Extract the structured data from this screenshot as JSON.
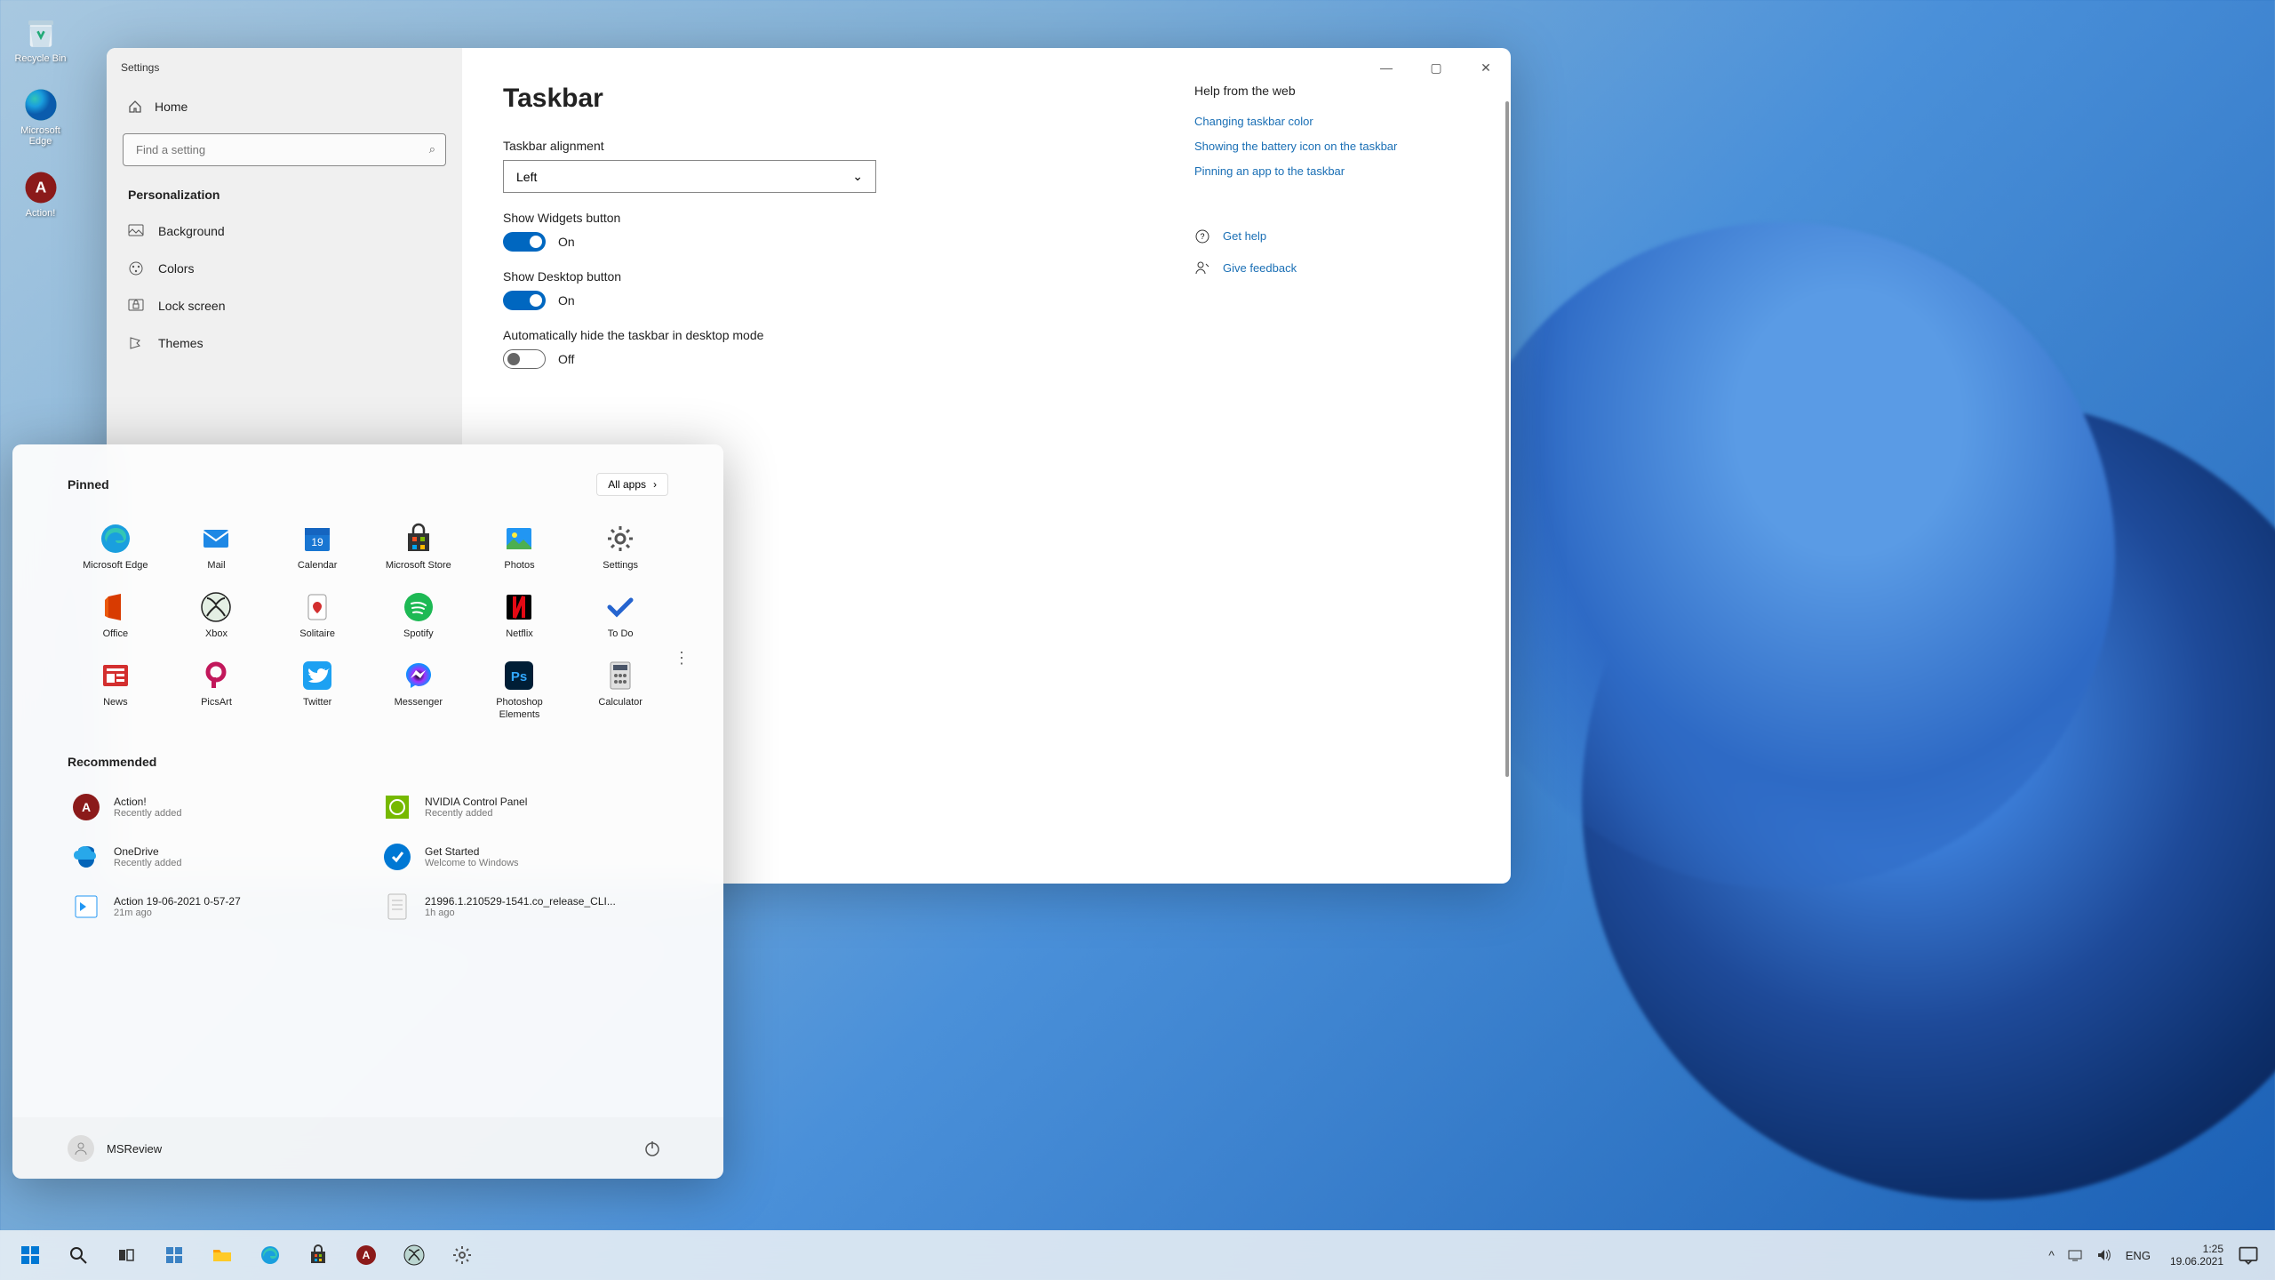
{
  "desktop": {
    "icons": [
      {
        "name": "Recycle Bin"
      },
      {
        "name": "Microsoft Edge"
      },
      {
        "name": "Action!"
      }
    ]
  },
  "settings": {
    "window_title": "Settings",
    "home_label": "Home",
    "search_placeholder": "Find a setting",
    "category": "Personalization",
    "nav": [
      {
        "label": "Background"
      },
      {
        "label": "Colors"
      },
      {
        "label": "Lock screen"
      },
      {
        "label": "Themes"
      }
    ],
    "page_title": "Taskbar",
    "alignment": {
      "label": "Taskbar alignment",
      "value": "Left"
    },
    "widgets": {
      "label": "Show Widgets button",
      "state": "On",
      "on": true
    },
    "desktop_btn": {
      "label": "Show Desktop button",
      "state": "On",
      "on": true
    },
    "autohide": {
      "label": "Automatically hide the taskbar in desktop mode",
      "state": "Off",
      "on": false
    },
    "help": {
      "title": "Help from the web",
      "links": [
        "Changing taskbar color",
        "Showing the battery icon on the taskbar",
        "Pinning an app to the taskbar"
      ],
      "get_help": "Get help",
      "feedback": "Give feedback"
    }
  },
  "start": {
    "pinned_label": "Pinned",
    "all_apps_label": "All apps",
    "recommended_label": "Recommended",
    "apps": [
      {
        "name": "Microsoft Edge"
      },
      {
        "name": "Mail"
      },
      {
        "name": "Calendar"
      },
      {
        "name": "Microsoft Store"
      },
      {
        "name": "Photos"
      },
      {
        "name": "Settings"
      },
      {
        "name": "Office"
      },
      {
        "name": "Xbox"
      },
      {
        "name": "Solitaire"
      },
      {
        "name": "Spotify"
      },
      {
        "name": "Netflix"
      },
      {
        "name": "To Do"
      },
      {
        "name": "News"
      },
      {
        "name": "PicsArt"
      },
      {
        "name": "Twitter"
      },
      {
        "name": "Messenger"
      },
      {
        "name": "Photoshop Elements"
      },
      {
        "name": "Calculator"
      }
    ],
    "recommended": [
      {
        "name": "Action!",
        "detail": "Recently added"
      },
      {
        "name": "NVIDIA Control Panel",
        "detail": "Recently added"
      },
      {
        "name": "OneDrive",
        "detail": "Recently added"
      },
      {
        "name": "Get Started",
        "detail": "Welcome to Windows"
      },
      {
        "name": "Action 19-06-2021 0-57-27",
        "detail": "21m ago"
      },
      {
        "name": "21996.1.210529-1541.co_release_CLI...",
        "detail": "1h ago"
      }
    ],
    "user": "MSReview"
  },
  "taskbar": {
    "lang": "ENG",
    "time": "1:25",
    "date": "19.06.2021"
  }
}
